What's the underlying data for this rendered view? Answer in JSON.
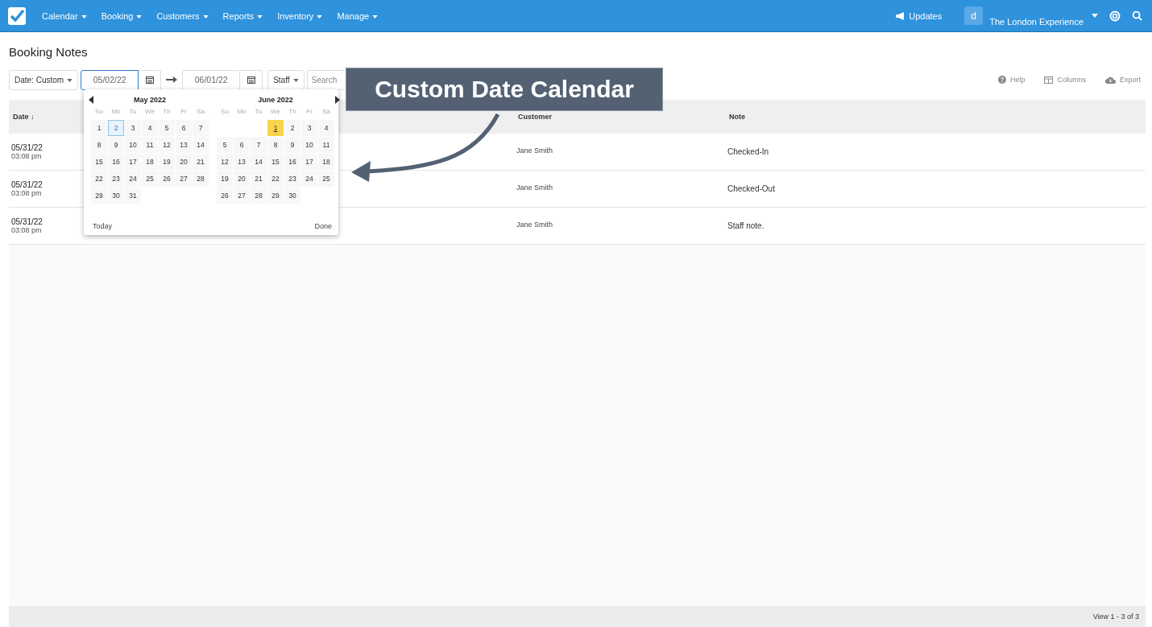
{
  "nav": {
    "menus": [
      {
        "label": "Calendar"
      },
      {
        "label": "Booking"
      },
      {
        "label": "Customers"
      },
      {
        "label": "Reports"
      },
      {
        "label": "Inventory"
      },
      {
        "label": "Manage"
      }
    ],
    "updates": "Updates",
    "avatar": "d",
    "company": "The London Experience"
  },
  "page": {
    "title": "Booking Notes"
  },
  "toolbar": {
    "date_filter": "Date: Custom",
    "start": "05/02/22",
    "end": "06/01/22",
    "staff": "Staff",
    "search": {
      "placeholder": "Search"
    },
    "actions": [
      {
        "label": "Help",
        "kind": "help"
      },
      {
        "label": "Columns",
        "kind": "columns"
      },
      {
        "label": "Export",
        "kind": "export"
      }
    ]
  },
  "table": {
    "columns": [
      {
        "label": "Date ↓"
      },
      {
        "label": "Customer"
      },
      {
        "label": "Note"
      }
    ],
    "rows": [
      {
        "date": "05/31/22",
        "time": "03:08 pm",
        "customer": "Jane Smith",
        "note": "Checked-In"
      },
      {
        "date": "05/31/22",
        "time": "03:08 pm",
        "customer": "Jane Smith",
        "note": "Checked-Out"
      },
      {
        "date": "05/31/22",
        "time": "03:08 pm",
        "customer": "Jane Smith",
        "note": "Staff note."
      }
    ]
  },
  "calendar": {
    "months": [
      {
        "title": "May 2022",
        "weekdays": [
          "Su",
          "Mo",
          "Tu",
          "We",
          "Th",
          "Fr",
          "Sa"
        ],
        "weeks": [
          {
            "days": [
              "1",
              {
                "day": "2",
                "kind": "selected"
              },
              "3",
              "4",
              "5",
              "6",
              "7"
            ]
          },
          {
            "days": [
              "8",
              "9",
              "10",
              "11",
              "12",
              "13",
              "14"
            ]
          },
          {
            "days": [
              "15",
              "16",
              "17",
              "18",
              "19",
              "20",
              "21"
            ]
          },
          {
            "days": [
              "22",
              "23",
              "24",
              "25",
              "26",
              "27",
              "28"
            ]
          },
          {
            "days": [
              "29",
              "30",
              "31"
            ]
          }
        ]
      },
      {
        "title": "June 2022",
        "weekdays": [
          "Su",
          "Mo",
          "Tu",
          "We",
          "Th",
          "Fr",
          "Sa"
        ],
        "weeks": [
          {
            "days": [
              {
                "day": "1",
                "kind": "today"
              },
              "2",
              "3",
              "4"
            ],
            "kind": "partial-start"
          },
          {
            "days": [
              "5",
              "6",
              "7",
              "8",
              "9",
              "10",
              "11"
            ]
          },
          {
            "days": [
              "12",
              "13",
              "14",
              "15",
              "16",
              "17",
              "18"
            ]
          },
          {
            "days": [
              "19",
              "20",
              "21",
              "22",
              "23",
              "24",
              "25"
            ]
          },
          {
            "days": [
              "26",
              "27",
              "28",
              "29",
              "30"
            ]
          }
        ]
      }
    ],
    "today": "Today",
    "done": "Done"
  },
  "callout": {
    "text": "Custom Date Calendar"
  },
  "footer": {
    "pager": "View 1 - 3 of 3"
  }
}
